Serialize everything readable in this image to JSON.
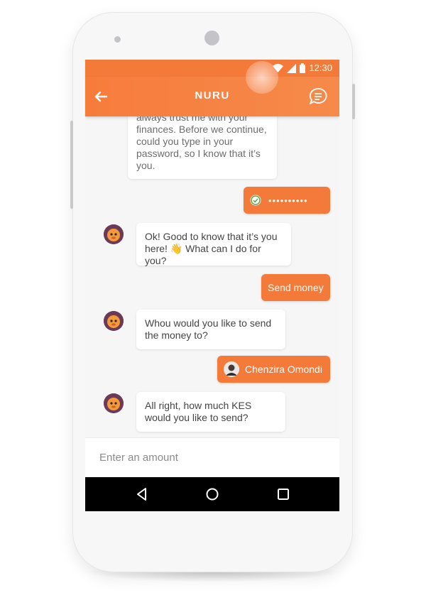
{
  "status_bar": {
    "time": "12:30"
  },
  "app_bar": {
    "title": "NURU"
  },
  "messages": [
    {
      "sender": "bot",
      "text": "All right!  You know, you can always trust me with your finances. Before we continue, could you type in your password, so I know that it’s you."
    },
    {
      "sender": "user",
      "text": "••••••••••"
    },
    {
      "sender": "bot",
      "text": "Ok! Good to know that it’s you here! 👋 What can I do for you?"
    },
    {
      "sender": "user",
      "text": "Send money"
    },
    {
      "sender": "bot",
      "text": "Whou would you like to send the money to?"
    },
    {
      "sender": "user",
      "text": "Chenzira Omondi"
    },
    {
      "sender": "bot",
      "text": "All right, how much KES would you like to send?"
    }
  ],
  "input": {
    "placeholder": "Enter an amount",
    "value": ""
  },
  "colors": {
    "accent": "#f47a3a",
    "screen_bg": "#f6f6f6",
    "bubble_bg": "#ffffff",
    "nav_bar": "#000000"
  },
  "icons": {
    "back": "arrow-left-icon",
    "chat": "chat-icon",
    "check": "check-circle-icon",
    "wifi": "wifi-icon",
    "signal": "signal-icon",
    "battery": "battery-icon",
    "nav_back": "nav-back-icon",
    "nav_home": "nav-home-icon",
    "nav_recents": "nav-recents-icon"
  }
}
